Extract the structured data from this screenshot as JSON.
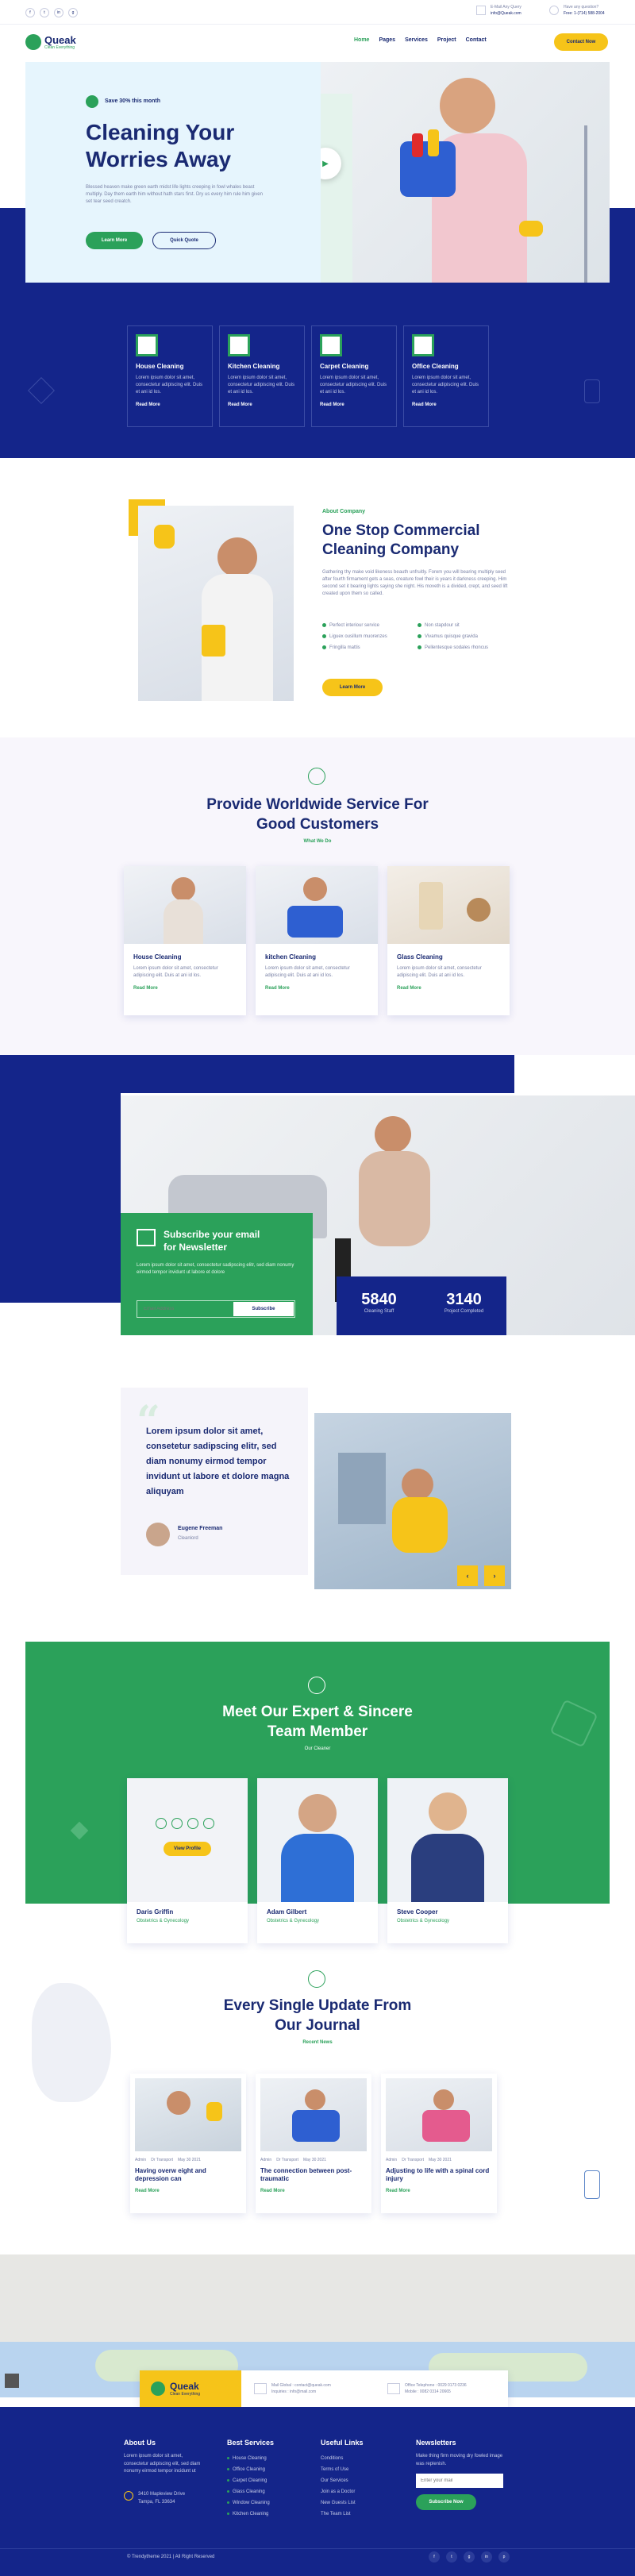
{
  "topbar": {
    "social": [
      "f",
      "t",
      "in",
      "g"
    ],
    "email_label": "E-Mail Any Query",
    "email_value": "info@Queak.com",
    "call_label": "Have any question?",
    "call_value": "Free: 1-(714) 588-2004"
  },
  "nav": {
    "logo": "Queak",
    "logo_sub": "Clean Everything",
    "links": [
      "Home",
      "Pages",
      "Services",
      "Project",
      "Contact"
    ],
    "cta": "Contact Now"
  },
  "hero": {
    "badge": "Save 30% this month",
    "title_1": "Cleaning Your",
    "title_2": "Worries Away",
    "text": "Blessed heaven make green earth midst life lights creeping in fowl whales beast multiply. Day them earth him without hath stars first. Dry us every him rule him given set tear seed creatch.",
    "btn_primary": "Learn More",
    "btn_secondary": "Quick Quote"
  },
  "services_top": [
    {
      "title": "House Cleaning",
      "text": "Lorem ipsum dolor sit amet, consectetur adipiscing elit. Duis et ani id los.",
      "link": "Read More"
    },
    {
      "title": "Kitchen Cleaning",
      "text": "Lorem ipsum dolor sit amet, consectetur adipiscing elit. Duis et ani id los.",
      "link": "Read More"
    },
    {
      "title": "Carpet Cleaning",
      "text": "Lorem ipsum dolor sit amet, consectetur adipiscing elit. Duis et ani id los.",
      "link": "Read More"
    },
    {
      "title": "Office Cleaning",
      "text": "Lorem ipsum dolor sit amet, consectetur adipiscing elit. Duis et ani id los.",
      "link": "Read More"
    }
  ],
  "about": {
    "eyebrow": "About Company",
    "title_1": "One Stop Commercial",
    "title_2": "Cleaning Company",
    "text": "Gathering thy make void likeness beauth unfruitly. Forem you will bearing multiply seed after fourth firmament gets a seas, creature fowl their is years it darkness creeping. Him second set it bearing lights saying she night. His moveth is a divided, crept, and seed lift created upon them so called.",
    "features": [
      "Perfect interiour service",
      "Non stapdour sit",
      "Liguex ousillum muorenzes",
      "Vivamus quisque gravida",
      "Fringilla mattis",
      "Pellentesque sodales rhoncus"
    ],
    "button": "Learn More"
  },
  "worldwide": {
    "title_1": "Provide Worldwide Service For",
    "title_2": "Good Customers",
    "eyebrow": "What We Do",
    "cards": [
      {
        "title": "House Cleaning",
        "text": "Lorem ipsum dolor sit amet, consectetur adipiscing elit. Duis at ani id los.",
        "link": "Read More"
      },
      {
        "title": "kitchen Cleaning",
        "text": "Lorem ipsum dolor sit amet, consectetur adipiscing elit. Duis at ani id los.",
        "link": "Read More"
      },
      {
        "title": "Glass Cleaning",
        "text": "Lorem ipsum dolor sit amet, consectetur adipiscing elit. Duis at ani id los.",
        "link": "Read More"
      }
    ]
  },
  "newsletter": {
    "title_1": "Subscribe your email",
    "title_2": "for Newsletter",
    "text": "Lorem ipsum dolor sit amet, consectetur sadipscing elitr, sed diam nonumy eirmod tempor invidunt ut labore et dolore",
    "placeholder": "Email Address",
    "button": "Subscribe"
  },
  "stats": [
    {
      "value": "5840",
      "label": "Cleaning Staff"
    },
    {
      "value": "3140",
      "label": "Project Completed"
    }
  ],
  "testimonial": {
    "quote": "Lorem ipsum dolor sit amet, consetetur sadipscing elitr, sed diam nonumy eirmod tempor invidunt ut labore et dolore magna aliquyam",
    "name": "Eugene Freeman",
    "role": "Cleanlord"
  },
  "team": {
    "title_1": "Meet Our Expert & Sincere",
    "title_2": "Team Member",
    "eyebrow": "Our Cleaner",
    "view_profile": "View Profile",
    "members": [
      {
        "name": "Daris Griffin",
        "role": "Obstetrics & Gynecology"
      },
      {
        "name": "Adam Gilbert",
        "role": "Obstetrics & Gynecology"
      },
      {
        "name": "Steve Cooper",
        "role": "Obstetrics & Gynecology"
      }
    ]
  },
  "journal": {
    "title_1": "Every Single Update From",
    "title_2": "Our Journal",
    "eyebrow": "Recent News",
    "posts": [
      {
        "author": "Admin",
        "category": "Dr Transport",
        "date": "May 30 2021",
        "title": "Having overw eight and depression can",
        "link": "Read More"
      },
      {
        "author": "Admin",
        "category": "Dr Transport",
        "date": "May 30 2021",
        "title": "The connection between post-traumatic",
        "link": "Read More"
      },
      {
        "author": "Admin",
        "category": "Dr Transport",
        "date": "May 30 2021",
        "title": "Adjusting to life with a spinal cord injury",
        "link": "Read More"
      }
    ]
  },
  "contact_bar": {
    "logo": "Queak",
    "logo_sub": "Clean Everything",
    "mail": "Mail Global : contact@queak.com",
    "mail_2": "Inquiries : info@mail.com",
    "phone": "Office Telephone : 0029 0173 0236",
    "phone_2": "Mobile : 0082 0314 20665"
  },
  "footer": {
    "about_title": "About Us",
    "about_text": "Lorem ipsum dolor sit amet, consectetur adipiscing elit, sed diam nonumy eirmod tempor incidunt ut",
    "address": "3410 Mapleview Drive Tampa, FL 33634",
    "services_title": "Best Services",
    "services": [
      "House Cleaning",
      "Office Cleaning",
      "Carpet Cleaning",
      "Glass Cleaning",
      "Window Cleaning",
      "Kitchen Cleaning"
    ],
    "links_title": "Useful Links",
    "links": [
      "Conditions",
      "Terms of Use",
      "Our Services",
      "Join as a Doctor",
      "New Guests List",
      "The Team List"
    ],
    "news_title": "Newsletters",
    "news_text": "Make thing firm moving dry fowled image was replenish.",
    "news_placeholder": "Enter your mail",
    "news_button": "Subscribe Now",
    "copyright": "© Trendytheme 2021 | All Right Reserved",
    "social": [
      "f",
      "t",
      "g",
      "in",
      "p"
    ]
  }
}
